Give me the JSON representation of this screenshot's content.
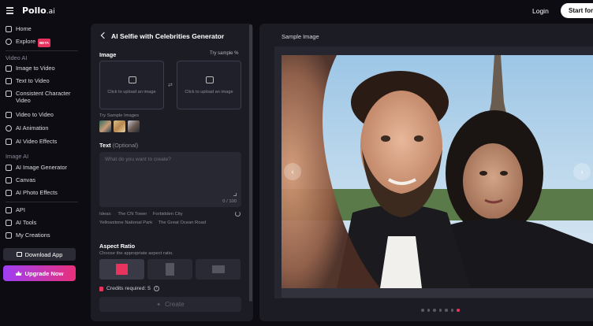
{
  "topbar": {
    "logo_main": "Pollo",
    "logo_suffix": ".ai",
    "login": "Login",
    "start_button": "Start for Free"
  },
  "sidebar": {
    "home": "Home",
    "explore": "Explore",
    "explore_badge": "BETA",
    "video_ai_label": "Video AI",
    "image_to_video": "Image to Video",
    "text_to_video": "Text to Video",
    "consistent_character_video": "Consistent Character Video",
    "video_to_video": "Video to Video",
    "ai_animation": "AI Animation",
    "ai_video_effects": "AI Video Effects",
    "image_ai_label": "Image AI",
    "ai_image_generator": "AI Image Generator",
    "canvas": "Canvas",
    "ai_photo_effects": "AI Photo Effects",
    "api": "API",
    "ai_tools": "AI Tools",
    "my_creations": "My Creations",
    "download_app": "Download App",
    "upgrade_now": "Upgrade Now"
  },
  "panel": {
    "title": "AI Selfie with Celebrities Generator",
    "image_label": "Image",
    "try_sample": "Try sample",
    "upload_text_1": "Click to upload an image",
    "upload_text_2": "Click to upload an image",
    "try_sample_images": "Try Sample Images",
    "text_label": "Text",
    "text_optional": "(Optional)",
    "text_placeholder": "What do you want to create?",
    "char_count": "0 / 100",
    "ideas_label": "Ideas:",
    "ideas": [
      "The CN Tower",
      "Forbidden City",
      "Yellowstone National Park",
      "The Great Ocean Road"
    ],
    "aspect_ratio_label": "Aspect Ratio",
    "aspect_ratio_sub": "Choose the appropriate aspect ratio.",
    "credits": "Credits required: 5",
    "create_button": "Create"
  },
  "right": {
    "sample_image_label": "Sample Image",
    "carousel_total": 7,
    "carousel_active": 7
  },
  "colors": {
    "accent": "#e8335e",
    "panel_bg": "#1c1c25",
    "page_bg": "#0c0c12"
  }
}
